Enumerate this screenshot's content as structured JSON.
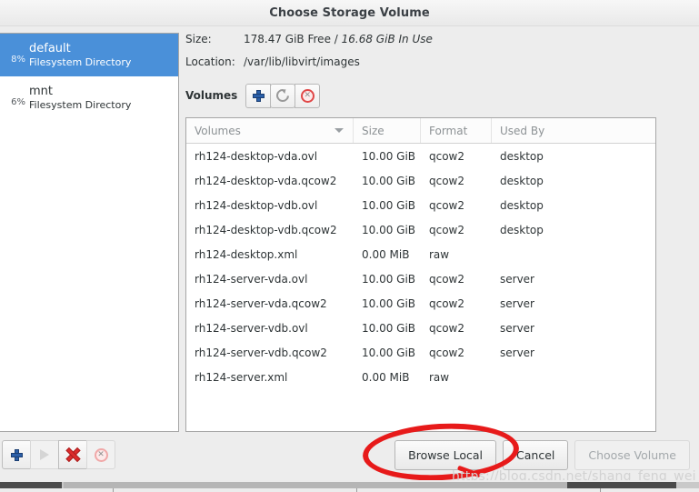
{
  "window": {
    "title": "Choose Storage Volume"
  },
  "pools": {
    "items": [
      {
        "percent": "8%",
        "name": "default",
        "type": "Filesystem Directory",
        "selected": true
      },
      {
        "percent": "6%",
        "name": "mnt",
        "type": "Filesystem Directory",
        "selected": false
      }
    ],
    "actions": [
      {
        "name": "add-pool-button",
        "icon": "plus-icon",
        "enabled": true
      },
      {
        "name": "start-pool-button",
        "icon": "play-icon",
        "enabled": false
      },
      {
        "name": "stop-pool-button",
        "icon": "red-x-icon",
        "enabled": true
      },
      {
        "name": "delete-pool-button",
        "icon": "delete-circle-icon",
        "enabled": false
      }
    ]
  },
  "details": {
    "size_label": "Size:",
    "size_free": "178.47 GiB Free /",
    "size_used": "16.68 GiB In Use",
    "location_label": "Location:",
    "location_value": "/var/lib/libvirt/images",
    "volumes_label": "Volumes",
    "toolbar": [
      {
        "name": "new-volume-button",
        "icon": "plus-icon",
        "enabled": true
      },
      {
        "name": "refresh-volumes-button",
        "icon": "refresh-icon",
        "enabled": false
      },
      {
        "name": "delete-volume-button",
        "icon": "delete-circle-icon",
        "enabled": true
      }
    ]
  },
  "table": {
    "columns": [
      "Volumes",
      "Size",
      "Format",
      "Used By"
    ],
    "sorted_column": "Volumes",
    "rows": [
      {
        "name": "rh124-desktop-vda.ovl",
        "size": "10.00 GiB",
        "format": "qcow2",
        "used_by": "desktop"
      },
      {
        "name": "rh124-desktop-vda.qcow2",
        "size": "10.00 GiB",
        "format": "qcow2",
        "used_by": "desktop"
      },
      {
        "name": "rh124-desktop-vdb.ovl",
        "size": "10.00 GiB",
        "format": "qcow2",
        "used_by": "desktop"
      },
      {
        "name": "rh124-desktop-vdb.qcow2",
        "size": "10.00 GiB",
        "format": "qcow2",
        "used_by": "desktop"
      },
      {
        "name": "rh124-desktop.xml",
        "size": "0.00 MiB",
        "format": "raw",
        "used_by": ""
      },
      {
        "name": "rh124-server-vda.ovl",
        "size": "10.00 GiB",
        "format": "qcow2",
        "used_by": "server"
      },
      {
        "name": "rh124-server-vda.qcow2",
        "size": "10.00 GiB",
        "format": "qcow2",
        "used_by": "server"
      },
      {
        "name": "rh124-server-vdb.ovl",
        "size": "10.00 GiB",
        "format": "qcow2",
        "used_by": "server"
      },
      {
        "name": "rh124-server-vdb.qcow2",
        "size": "10.00 GiB",
        "format": "qcow2",
        "used_by": "server"
      },
      {
        "name": "rh124-server.xml",
        "size": "0.00 MiB",
        "format": "raw",
        "used_by": ""
      }
    ]
  },
  "buttons": {
    "browse_local": "Browse Local",
    "cancel": "Cancel",
    "choose_volume": "Choose Volume"
  },
  "annotation": {
    "shape": "red-ellipse",
    "target": "Browse Local",
    "color": "#e71a1a"
  },
  "watermark": "https://blog.csdn.net/shang_feng_wei",
  "colors": {
    "selection": "#4a90d9",
    "window_bg": "#ededed",
    "annotation": "#e71a1a"
  }
}
